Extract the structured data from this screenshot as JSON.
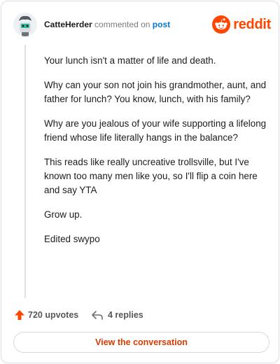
{
  "header": {
    "username": "CatteHerder",
    "action_text": "commented on",
    "target_link": "post",
    "logo_text": "reddit",
    "logo_icon": "reddit-snoo-icon",
    "avatar_icon": "user-avatar"
  },
  "comment": {
    "paragraphs": [
      "Your lunch isn't a matter of life and death.",
      "Why can your son not join his grandmother, aunt, and father for lunch? You know, lunch, with his family?",
      "Why are you jealous of your wife supporting a lifelong friend whose life literally hangs in the balance?",
      "This reads like really uncreative trollsville, but I've known too many men like you, so I'll flip a coin here and say YTA",
      "Grow up.",
      "Edited swypo"
    ]
  },
  "footer": {
    "upvotes_label": "720 upvotes",
    "replies_label": "4 replies",
    "upvote_icon": "upvote-arrow-icon",
    "reply_icon": "reply-arrow-icon"
  },
  "cta": {
    "label": "View the conversation"
  },
  "colors": {
    "brand": "#ff4500",
    "link": "#0079d3",
    "cta_text": "#d93a00",
    "thread_line": "#dde1e4"
  }
}
